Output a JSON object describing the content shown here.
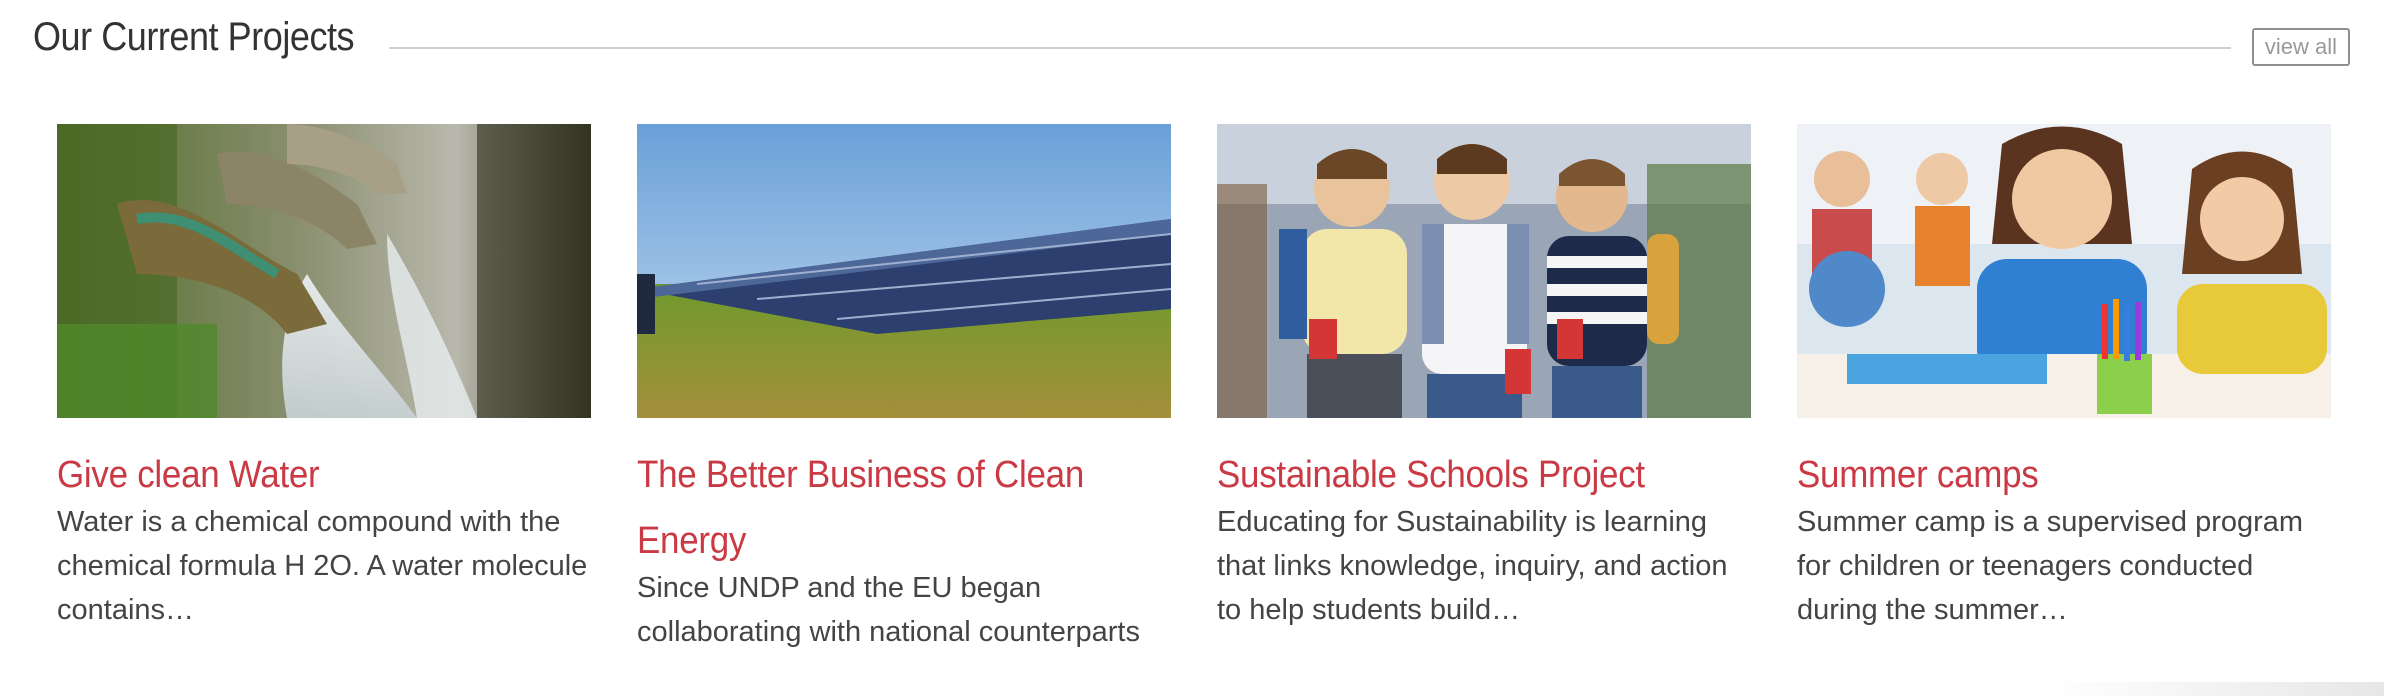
{
  "section": {
    "title": "Our Current Projects",
    "view_all_label": "view all"
  },
  "colors": {
    "accent": "#c93a45",
    "text": "#444444",
    "rule": "#d0d0d0"
  },
  "cards": [
    {
      "title": "Give clean Water",
      "text": "Water is a chemical compound with the chemical formula H 2O. A water molecule contains…",
      "image": "water-fountain-image"
    },
    {
      "title": "The Better Business of Clean Energy",
      "text": "Since UNDP and the EU began collaborating with national counterparts",
      "image": "solar-panels-image"
    },
    {
      "title": "Sustainable Schools Project",
      "text": "Educating for Sustainability is learning that links knowledge, inquiry, and action to help students build…",
      "image": "schoolboys-image"
    },
    {
      "title": "Summer camps",
      "text": "Summer camp is a supervised program for children or teenagers conducted during the summer…",
      "image": "children-drawing-image"
    }
  ]
}
